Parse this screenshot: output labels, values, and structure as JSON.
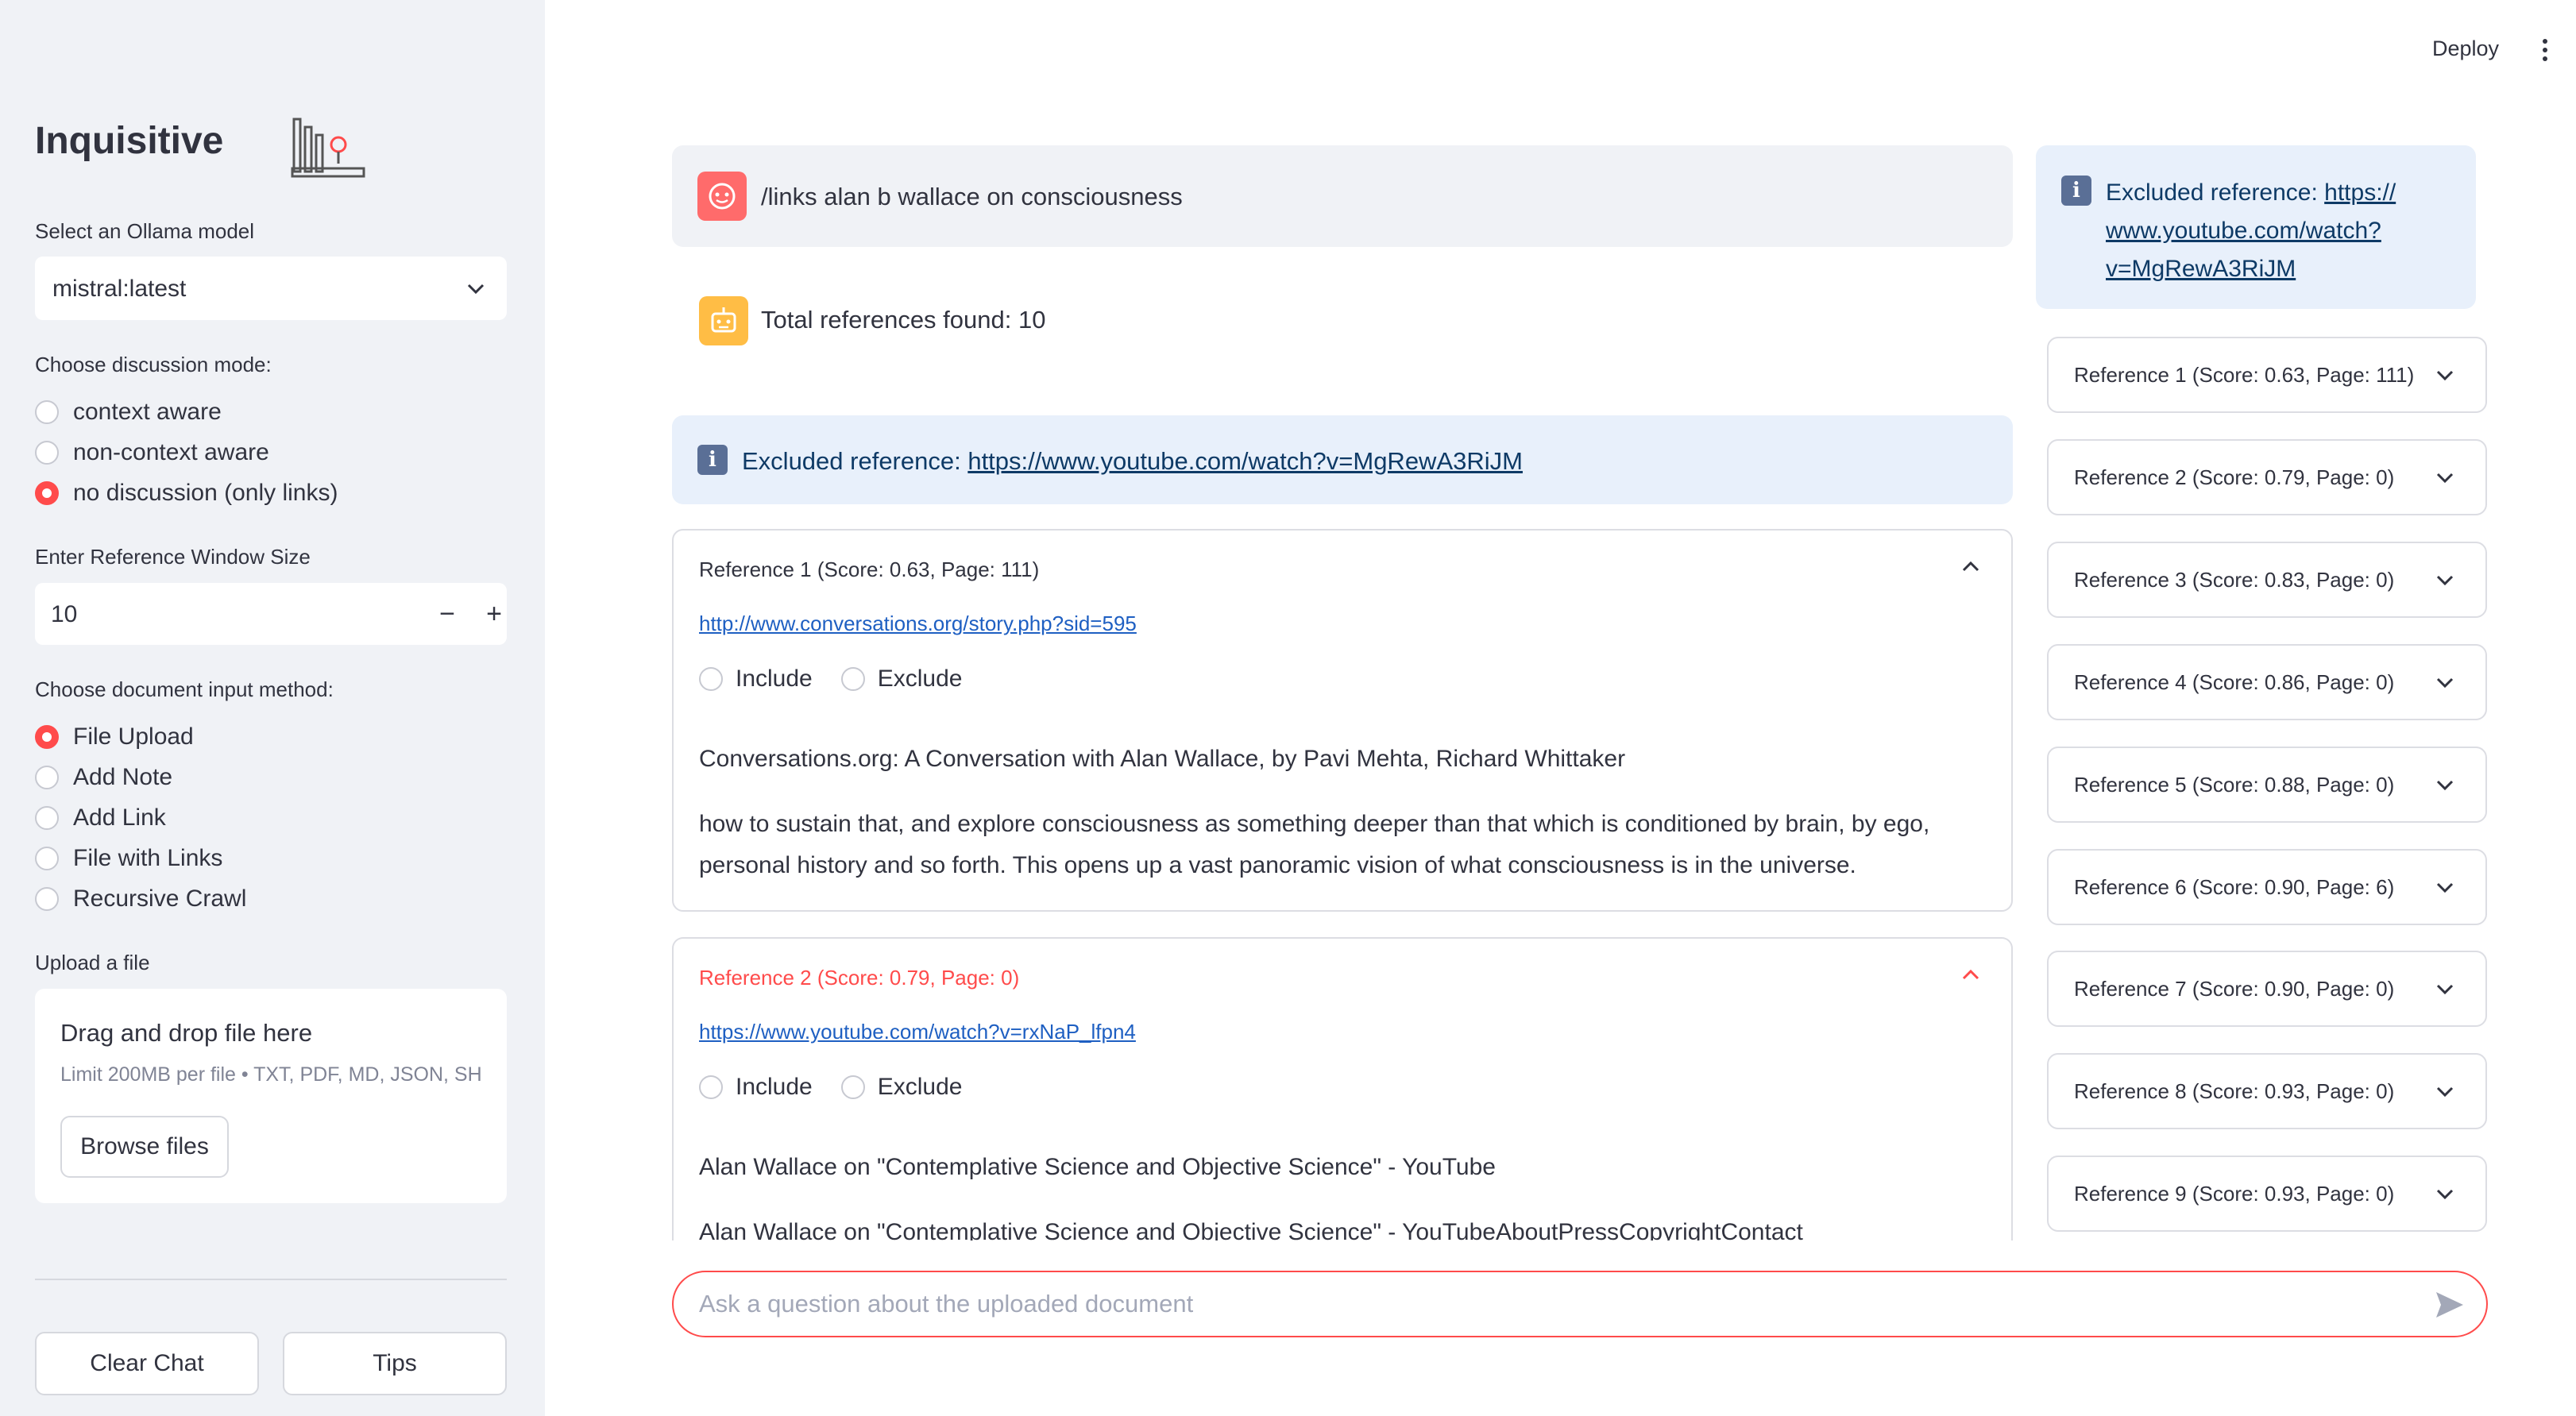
{
  "header": {
    "deploy_label": "Deploy"
  },
  "sidebar": {
    "title": "Inquisitive",
    "model_label": "Select an Ollama model",
    "model_value": "mistral:latest",
    "mode_label": "Choose discussion mode:",
    "modes": [
      "context aware",
      "non-context aware",
      "no discussion (only links)"
    ],
    "window_label": "Enter Reference Window Size",
    "window_value": "10",
    "input_method_label": "Choose document input method:",
    "input_methods": [
      "File Upload",
      "Add Note",
      "Add Link",
      "File with Links",
      "Recursive Crawl"
    ],
    "upload_label": "Upload a file",
    "upload_drag": "Drag and drop file here",
    "upload_limit": "Limit 200MB per file • TXT, PDF, MD, JSON, SH",
    "browse_label": "Browse files",
    "clear_label": "Clear Chat",
    "tips_label": "Tips"
  },
  "chat": {
    "user_message": "/links alan b wallace on consciousness",
    "bot_message": "Total references found: 10",
    "excluded_prefix": "Excluded reference: ",
    "excluded_url": "https://www.youtube.com/watch?v=MgRewA3RiJM",
    "include_label": "Include",
    "exclude_label": "Exclude",
    "ref1": {
      "title": "Reference 1 (Score: 0.63, Page: 111)",
      "url": "http://www.conversations.org/story.php?sid=595",
      "heading": "Conversations.org: A Conversation with Alan Wallace, by Pavi Mehta, Richard Whittaker",
      "excerpt": "how to sustain that, and explore consciousness as something deeper than that which is conditioned by brain, by ego, personal history and so forth. This opens up a vast panoramic vision of what consciousness is in the universe."
    },
    "ref2": {
      "title": "Reference 2 (Score: 0.79, Page: 0)",
      "url": "https://www.youtube.com/watch?v=rxNaP_lfpn4",
      "heading": "Alan Wallace on \"Contemplative Science and Objective Science\" - YouTube",
      "excerpt": "Alan Wallace on \"Contemplative Science and Objective Science\" - YouTubeAboutPressCopyrightContact"
    },
    "input_placeholder": "Ask a question about the uploaded document"
  },
  "right_panel": {
    "excluded_prefix": "Excluded reference: ",
    "excluded_url_line1": "https://",
    "excluded_url_line2": "www.youtube.com/watch?",
    "excluded_url_line3": "v=MgRewA3RiJM",
    "references": [
      "Reference 1 (Score: 0.63, Page: 111)",
      "Reference 2 (Score: 0.79, Page: 0)",
      "Reference 3 (Score: 0.83, Page: 0)",
      "Reference 4 (Score: 0.86, Page: 0)",
      "Reference 5 (Score: 0.88, Page: 0)",
      "Reference 6 (Score: 0.90, Page: 6)",
      "Reference 7 (Score: 0.90, Page: 0)",
      "Reference 8 (Score: 0.93, Page: 0)",
      "Reference 9 (Score: 0.93, Page: 0)"
    ]
  },
  "colors": {
    "accent": "#ff4b4b",
    "sidebar_bg": "#f0f2f6",
    "info_bg": "#e8f0fb",
    "bot_avatar": "#ffbd45"
  },
  "icons": [
    "logo-icon",
    "chevron-down-icon",
    "user-avatar-icon",
    "bot-avatar-icon",
    "info-icon",
    "chevron-up-icon",
    "send-icon",
    "kebab-menu-icon"
  ]
}
